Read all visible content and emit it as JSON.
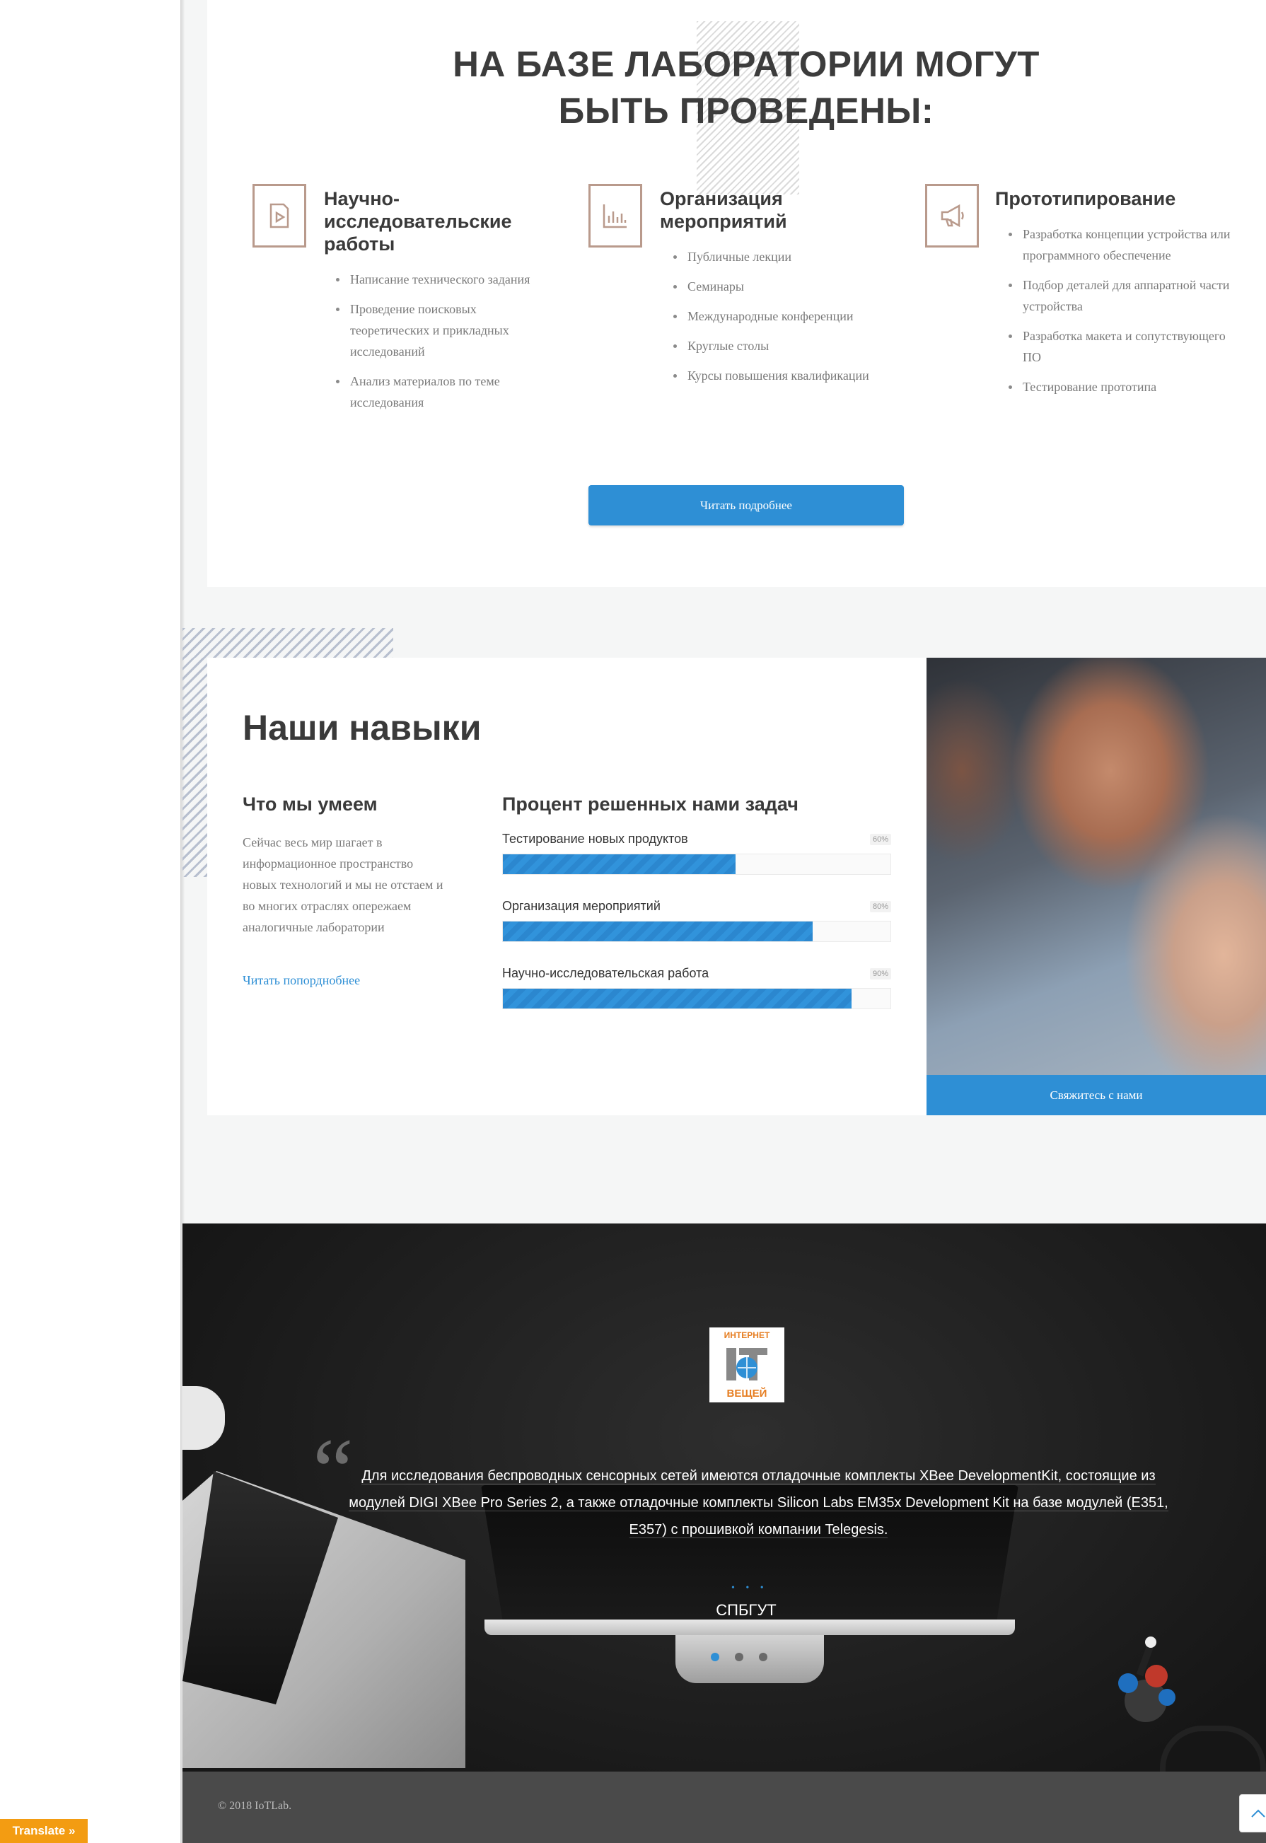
{
  "services": {
    "title_line1": "НА БАЗЕ ЛАБОРАТОРИИ МОГУТ",
    "title_line2": "БЫТЬ ПРОВЕДЕНЫ:",
    "columns": [
      {
        "icon": "play-document-icon",
        "title": "Научно-исследовательские работы",
        "items": [
          "Написание технического задания",
          "Проведение поисковых теоретических и прикладных исследований",
          "Анализ материалов по теме исследования"
        ]
      },
      {
        "icon": "bar-chart-icon",
        "title": "Организация мероприятий",
        "items": [
          "Публичные лекции",
          "Семинары",
          "Международные конференции",
          "Круглые столы",
          "Курсы повышения квалификации"
        ]
      },
      {
        "icon": "megaphone-icon",
        "title": "Прототипирование",
        "items": [
          "Разработка концепции устройства или программного обеспечение",
          "Подбор деталей для аппаратной части устройства",
          "Разработка макета и сопутствующего ПО",
          "Тестирование прототипа"
        ]
      }
    ],
    "button": "Читать подробнее"
  },
  "skills": {
    "title": "Наши навыки",
    "left_heading": "Что мы умеем",
    "left_text": "Сейчас весь мир шагает в информационное пространство новых технологий и мы не отстаем и во многих отраслях опережаем аналогичные лаборатории",
    "left_link": "Читать попорднобнее",
    "right_heading": "Процент решенных нами задач",
    "bars": [
      {
        "label": "Тестирование новых продуктов",
        "percent_label": "60%",
        "value": 60
      },
      {
        "label": "Организация мероприятий",
        "percent_label": "80%",
        "value": 80
      },
      {
        "label": "Научно-исследовательская работа",
        "percent_label": "90%",
        "value": 90
      }
    ],
    "photo_button": "Свяжитесь с нами"
  },
  "testimonial": {
    "logo_top": "ИНТЕРНЕТ",
    "logo_bottom": "ВЕЩЕЙ",
    "quote": "Для исследования беспроводных сенсорных сетей имеются отладочные комплекты XBee DevelopmentKit, состоящие из модулей DIGI XBee Pro Series 2, а также отладочные комплекты Silicon Labs EM35x Development Kit на базе модулей (E351, E357) с прошивкой компании Telegesis.",
    "author": "СПБГУТ",
    "dots": "• • •",
    "active_slide": 1,
    "slide_count": 3
  },
  "footer": {
    "copyright": "© 2018 IoTLab."
  },
  "widgets": {
    "translate": "Translate »",
    "scroll_top_icon": "chevron-up-icon"
  },
  "colors": {
    "accent": "#2e8fd5",
    "icon_border": "#b99a8c",
    "translate": "#f39c12",
    "footer": "#4a4a4a"
  }
}
